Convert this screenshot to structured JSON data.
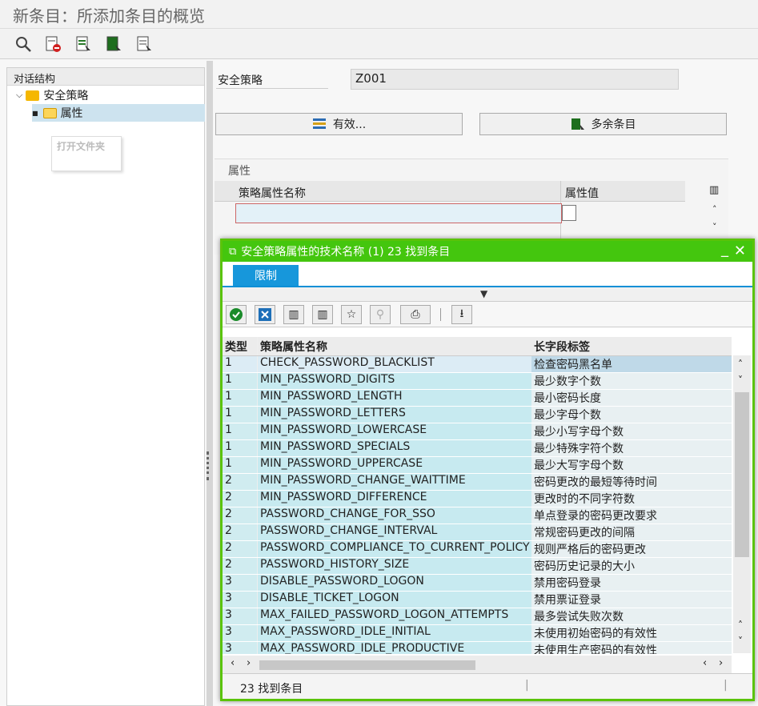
{
  "window_title": "新条目：所添加条目的概览",
  "toolbar": {
    "icons": [
      "display-icon",
      "delete-icon",
      "select-all-icon",
      "select-block-icon",
      "deselect-icon"
    ]
  },
  "tree": {
    "header": "对话结构",
    "root": "安全策略",
    "child": "属性",
    "tooltip": "打开文件夹"
  },
  "policy": {
    "label": "安全策略",
    "value": "Z001"
  },
  "buttons": {
    "valid": "有效...",
    "surplus": "多余条目"
  },
  "attributes": {
    "section": "属性",
    "col_name": "策略属性名称",
    "col_value": "属性值"
  },
  "dialog": {
    "title": "安全策略属性的技术名称 (1)   23 找到条目",
    "tab": "限制",
    "columns": [
      "类型",
      "策略属性名称",
      "长字段标签"
    ],
    "rows": [
      {
        "type": "1",
        "name": "CHECK_PASSWORD_BLACKLIST",
        "label": "检查密码黑名单"
      },
      {
        "type": "1",
        "name": "MIN_PASSWORD_DIGITS",
        "label": "最少数字个数"
      },
      {
        "type": "1",
        "name": "MIN_PASSWORD_LENGTH",
        "label": "最小密码长度"
      },
      {
        "type": "1",
        "name": "MIN_PASSWORD_LETTERS",
        "label": "最少字母个数"
      },
      {
        "type": "1",
        "name": "MIN_PASSWORD_LOWERCASE",
        "label": "最少小写字母个数"
      },
      {
        "type": "1",
        "name": "MIN_PASSWORD_SPECIALS",
        "label": "最少特殊字符个数"
      },
      {
        "type": "1",
        "name": "MIN_PASSWORD_UPPERCASE",
        "label": "最少大写字母个数"
      },
      {
        "type": "2",
        "name": "MIN_PASSWORD_CHANGE_WAITTIME",
        "label": "密码更改的最短等待时间"
      },
      {
        "type": "2",
        "name": "MIN_PASSWORD_DIFFERENCE",
        "label": "更改时的不同字符数"
      },
      {
        "type": "2",
        "name": "PASSWORD_CHANGE_FOR_SSO",
        "label": "单点登录的密码更改要求"
      },
      {
        "type": "2",
        "name": "PASSWORD_CHANGE_INTERVAL",
        "label": "常规密码更改的间隔"
      },
      {
        "type": "2",
        "name": "PASSWORD_COMPLIANCE_TO_CURRENT_POLICY",
        "label": "规则严格后的密码更改"
      },
      {
        "type": "2",
        "name": "PASSWORD_HISTORY_SIZE",
        "label": "密码历史记录的大小"
      },
      {
        "type": "3",
        "name": "DISABLE_PASSWORD_LOGON",
        "label": "禁用密码登录"
      },
      {
        "type": "3",
        "name": "DISABLE_TICKET_LOGON",
        "label": "禁用票证登录"
      },
      {
        "type": "3",
        "name": "MAX_FAILED_PASSWORD_LOGON_ATTEMPTS",
        "label": "最多尝试失败次数"
      },
      {
        "type": "3",
        "name": "MAX_PASSWORD_IDLE_INITIAL",
        "label": "未使用初始密码的有效性"
      },
      {
        "type": "3",
        "name": "MAX_PASSWORD_IDLE_PRODUCTIVE",
        "label": "未使用生产密码的有效性"
      }
    ],
    "status": "23 找到条目"
  },
  "colors": {
    "dialog_green": "#44c60e",
    "tab_blue": "#1797db"
  }
}
